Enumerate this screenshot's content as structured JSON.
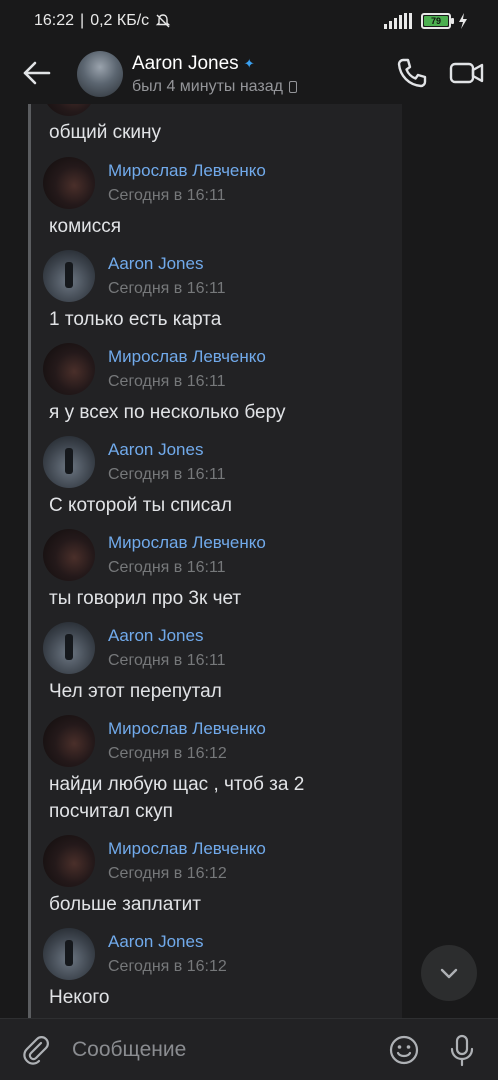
{
  "status_bar": {
    "time": "16:22",
    "network_speed": "0,2 КБ/с",
    "battery": "79"
  },
  "header": {
    "name": "Aaron Jones",
    "status": "был 4 минуты назад"
  },
  "messages": [
    {
      "text": "общий скину"
    },
    {
      "author": "Мирослав Левченко",
      "time": "Сегодня в 16:11",
      "text": "комисся",
      "avatar": "dark"
    },
    {
      "author": "Aaron Jones",
      "time": "Сегодня в 16:11",
      "text": "1 только  есть карта",
      "avatar": "light"
    },
    {
      "author": "Мирослав Левченко",
      "time": "Сегодня в 16:11",
      "text": "я у всех по несколько беру",
      "avatar": "dark"
    },
    {
      "author": "Aaron Jones",
      "time": "Сегодня в 16:11",
      "text": "С которой ты списал",
      "avatar": "light"
    },
    {
      "author": "Мирослав Левченко",
      "time": "Сегодня в 16:11",
      "text": "ты говорил про 3к чет",
      "avatar": "dark"
    },
    {
      "author": "Aaron Jones",
      "time": "Сегодня в 16:11",
      "text": "Чел этот перепутал",
      "avatar": "light"
    },
    {
      "author": "Мирослав Левченко",
      "time": "Сегодня в 16:12",
      "text": "найди любую щас , чтоб за 2\nпосчитал скуп",
      "avatar": "dark"
    },
    {
      "author": "Мирослав Левченко",
      "time": "Сегодня в 16:12",
      "text": "больше заплатит",
      "avatar": "dark"
    },
    {
      "author": "Aaron Jones",
      "time": "Сегодня в 16:12",
      "text": "Некого",
      "avatar": "light"
    }
  ],
  "composer": {
    "placeholder": "Сообщение"
  },
  "colors": {
    "background": "#19191a",
    "panel": "#222224",
    "author_link": "#71aaeb",
    "timestamp": "#76787a"
  }
}
